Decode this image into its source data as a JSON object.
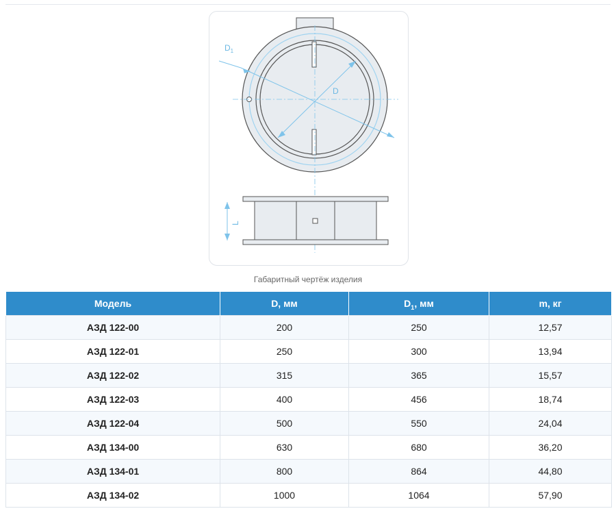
{
  "drawing": {
    "label_d1": "D",
    "label_d1_sub": "1",
    "label_d": "D",
    "label_l": "L"
  },
  "caption": "Габаритный чертёж изделия",
  "table": {
    "headers": [
      {
        "text": "Модель",
        "sub": ""
      },
      {
        "text": "D, мм",
        "sub": ""
      },
      {
        "text": "D",
        "sub": "1",
        "suffix": ", мм"
      },
      {
        "text": "m, кг",
        "sub": ""
      }
    ],
    "rows": [
      {
        "model": "АЗД 122-00",
        "d": "200",
        "d1": "250",
        "m": "12,57"
      },
      {
        "model": "АЗД 122-01",
        "d": "250",
        "d1": "300",
        "m": "13,94"
      },
      {
        "model": "АЗД 122-02",
        "d": "315",
        "d1": "365",
        "m": "15,57"
      },
      {
        "model": "АЗД 122-03",
        "d": "400",
        "d1": "456",
        "m": "18,74"
      },
      {
        "model": "АЗД 122-04",
        "d": "500",
        "d1": "550",
        "m": "24,04"
      },
      {
        "model": "АЗД 134-00",
        "d": "630",
        "d1": "680",
        "m": "36,20"
      },
      {
        "model": "АЗД 134-01",
        "d": "800",
        "d1": "864",
        "m": "44,80"
      },
      {
        "model": "АЗД 134-02",
        "d": "1000",
        "d1": "1064",
        "m": "57,90"
      }
    ]
  },
  "colors": {
    "header_bg": "#2f8ccb",
    "accent_line": "#7ec3ea",
    "drawing_fill": "#e8ecf0",
    "drawing_stroke": "#555555"
  }
}
